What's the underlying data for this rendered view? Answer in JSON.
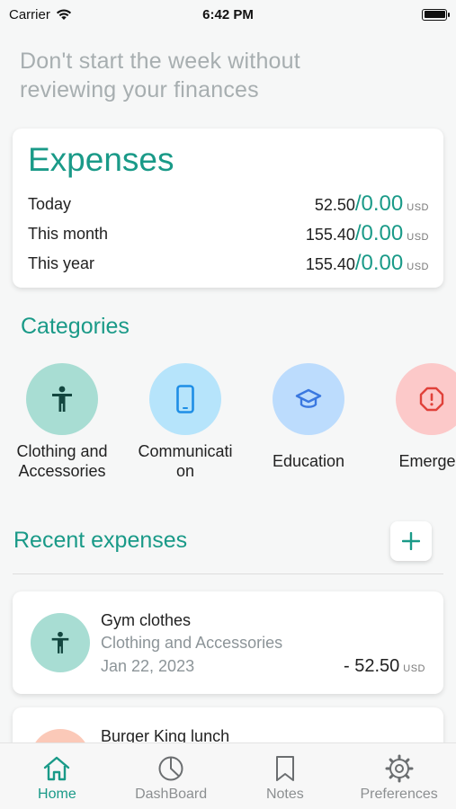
{
  "status": {
    "carrier": "Carrier",
    "time": "6:42 PM"
  },
  "headline": "Don't start the week without reviewing your finances",
  "expenses": {
    "title": "Expenses",
    "rows": [
      {
        "label": "Today",
        "spent": "52.50",
        "budget": "/0.00",
        "currency": "USD"
      },
      {
        "label": "This month",
        "spent": "155.40",
        "budget": "/0.00",
        "currency": "USD"
      },
      {
        "label": "This year",
        "spent": "155.40",
        "budget": "/0.00",
        "currency": "USD"
      }
    ]
  },
  "categories": {
    "title": "Categories",
    "items": [
      {
        "label": "Clothing and Accessories",
        "icon": "person-icon",
        "color": "#a8ddd3",
        "icon_color": "#13463f"
      },
      {
        "label": "Communicati on",
        "icon": "phone-icon",
        "color": "#b6e4fb",
        "icon_color": "#1e8ee6"
      },
      {
        "label": "Education",
        "icon": "graduation-cap-icon",
        "color": "#bcdcfd",
        "icon_color": "#3a78e0"
      },
      {
        "label": "Emergen",
        "icon": "alert-icon",
        "color": "#fcc9c9",
        "icon_color": "#e0413a"
      }
    ]
  },
  "recent": {
    "title": "Recent expenses",
    "add_icon": "plus-icon",
    "items": [
      {
        "name": "Gym clothes",
        "category": "Clothing and Accessories",
        "date": "Jan 22, 2023",
        "amount": "- 52.50",
        "currency": "USD",
        "color": "#a8ddd3"
      },
      {
        "name": "Burger King lunch",
        "category": "",
        "date": "",
        "amount": "",
        "currency": "",
        "color": "#fbc9b8"
      }
    ]
  },
  "tabs": [
    {
      "label": "Home",
      "icon": "home-icon",
      "active": true
    },
    {
      "label": "DashBoard",
      "icon": "pie-chart-icon",
      "active": false
    },
    {
      "label": "Notes",
      "icon": "bookmark-icon",
      "active": false
    },
    {
      "label": "Preferences",
      "icon": "gear-icon",
      "active": false
    }
  ],
  "colors": {
    "accent": "#1a9a88",
    "muted": "#8c9498"
  }
}
